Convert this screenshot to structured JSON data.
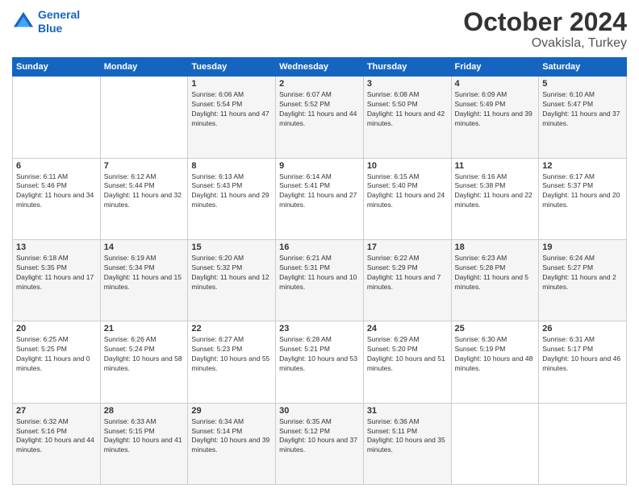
{
  "header": {
    "logo_line1": "General",
    "logo_line2": "Blue",
    "main_title": "October 2024",
    "subtitle": "Ovakisla, Turkey"
  },
  "weekdays": [
    "Sunday",
    "Monday",
    "Tuesday",
    "Wednesday",
    "Thursday",
    "Friday",
    "Saturday"
  ],
  "weeks": [
    [
      {
        "day": "",
        "sunrise": "",
        "sunset": "",
        "daylight": ""
      },
      {
        "day": "",
        "sunrise": "",
        "sunset": "",
        "daylight": ""
      },
      {
        "day": "1",
        "sunrise": "Sunrise: 6:06 AM",
        "sunset": "Sunset: 5:54 PM",
        "daylight": "Daylight: 11 hours and 47 minutes."
      },
      {
        "day": "2",
        "sunrise": "Sunrise: 6:07 AM",
        "sunset": "Sunset: 5:52 PM",
        "daylight": "Daylight: 11 hours and 44 minutes."
      },
      {
        "day": "3",
        "sunrise": "Sunrise: 6:08 AM",
        "sunset": "Sunset: 5:50 PM",
        "daylight": "Daylight: 11 hours and 42 minutes."
      },
      {
        "day": "4",
        "sunrise": "Sunrise: 6:09 AM",
        "sunset": "Sunset: 5:49 PM",
        "daylight": "Daylight: 11 hours and 39 minutes."
      },
      {
        "day": "5",
        "sunrise": "Sunrise: 6:10 AM",
        "sunset": "Sunset: 5:47 PM",
        "daylight": "Daylight: 11 hours and 37 minutes."
      }
    ],
    [
      {
        "day": "6",
        "sunrise": "Sunrise: 6:11 AM",
        "sunset": "Sunset: 5:46 PM",
        "daylight": "Daylight: 11 hours and 34 minutes."
      },
      {
        "day": "7",
        "sunrise": "Sunrise: 6:12 AM",
        "sunset": "Sunset: 5:44 PM",
        "daylight": "Daylight: 11 hours and 32 minutes."
      },
      {
        "day": "8",
        "sunrise": "Sunrise: 6:13 AM",
        "sunset": "Sunset: 5:43 PM",
        "daylight": "Daylight: 11 hours and 29 minutes."
      },
      {
        "day": "9",
        "sunrise": "Sunrise: 6:14 AM",
        "sunset": "Sunset: 5:41 PM",
        "daylight": "Daylight: 11 hours and 27 minutes."
      },
      {
        "day": "10",
        "sunrise": "Sunrise: 6:15 AM",
        "sunset": "Sunset: 5:40 PM",
        "daylight": "Daylight: 11 hours and 24 minutes."
      },
      {
        "day": "11",
        "sunrise": "Sunrise: 6:16 AM",
        "sunset": "Sunset: 5:38 PM",
        "daylight": "Daylight: 11 hours and 22 minutes."
      },
      {
        "day": "12",
        "sunrise": "Sunrise: 6:17 AM",
        "sunset": "Sunset: 5:37 PM",
        "daylight": "Daylight: 11 hours and 20 minutes."
      }
    ],
    [
      {
        "day": "13",
        "sunrise": "Sunrise: 6:18 AM",
        "sunset": "Sunset: 5:35 PM",
        "daylight": "Daylight: 11 hours and 17 minutes."
      },
      {
        "day": "14",
        "sunrise": "Sunrise: 6:19 AM",
        "sunset": "Sunset: 5:34 PM",
        "daylight": "Daylight: 11 hours and 15 minutes."
      },
      {
        "day": "15",
        "sunrise": "Sunrise: 6:20 AM",
        "sunset": "Sunset: 5:32 PM",
        "daylight": "Daylight: 11 hours and 12 minutes."
      },
      {
        "day": "16",
        "sunrise": "Sunrise: 6:21 AM",
        "sunset": "Sunset: 5:31 PM",
        "daylight": "Daylight: 11 hours and 10 minutes."
      },
      {
        "day": "17",
        "sunrise": "Sunrise: 6:22 AM",
        "sunset": "Sunset: 5:29 PM",
        "daylight": "Daylight: 11 hours and 7 minutes."
      },
      {
        "day": "18",
        "sunrise": "Sunrise: 6:23 AM",
        "sunset": "Sunset: 5:28 PM",
        "daylight": "Daylight: 11 hours and 5 minutes."
      },
      {
        "day": "19",
        "sunrise": "Sunrise: 6:24 AM",
        "sunset": "Sunset: 5:27 PM",
        "daylight": "Daylight: 11 hours and 2 minutes."
      }
    ],
    [
      {
        "day": "20",
        "sunrise": "Sunrise: 6:25 AM",
        "sunset": "Sunset: 5:25 PM",
        "daylight": "Daylight: 11 hours and 0 minutes."
      },
      {
        "day": "21",
        "sunrise": "Sunrise: 6:26 AM",
        "sunset": "Sunset: 5:24 PM",
        "daylight": "Daylight: 10 hours and 58 minutes."
      },
      {
        "day": "22",
        "sunrise": "Sunrise: 6:27 AM",
        "sunset": "Sunset: 5:23 PM",
        "daylight": "Daylight: 10 hours and 55 minutes."
      },
      {
        "day": "23",
        "sunrise": "Sunrise: 6:28 AM",
        "sunset": "Sunset: 5:21 PM",
        "daylight": "Daylight: 10 hours and 53 minutes."
      },
      {
        "day": "24",
        "sunrise": "Sunrise: 6:29 AM",
        "sunset": "Sunset: 5:20 PM",
        "daylight": "Daylight: 10 hours and 51 minutes."
      },
      {
        "day": "25",
        "sunrise": "Sunrise: 6:30 AM",
        "sunset": "Sunset: 5:19 PM",
        "daylight": "Daylight: 10 hours and 48 minutes."
      },
      {
        "day": "26",
        "sunrise": "Sunrise: 6:31 AM",
        "sunset": "Sunset: 5:17 PM",
        "daylight": "Daylight: 10 hours and 46 minutes."
      }
    ],
    [
      {
        "day": "27",
        "sunrise": "Sunrise: 6:32 AM",
        "sunset": "Sunset: 5:16 PM",
        "daylight": "Daylight: 10 hours and 44 minutes."
      },
      {
        "day": "28",
        "sunrise": "Sunrise: 6:33 AM",
        "sunset": "Sunset: 5:15 PM",
        "daylight": "Daylight: 10 hours and 41 minutes."
      },
      {
        "day": "29",
        "sunrise": "Sunrise: 6:34 AM",
        "sunset": "Sunset: 5:14 PM",
        "daylight": "Daylight: 10 hours and 39 minutes."
      },
      {
        "day": "30",
        "sunrise": "Sunrise: 6:35 AM",
        "sunset": "Sunset: 5:12 PM",
        "daylight": "Daylight: 10 hours and 37 minutes."
      },
      {
        "day": "31",
        "sunrise": "Sunrise: 6:36 AM",
        "sunset": "Sunset: 5:11 PM",
        "daylight": "Daylight: 10 hours and 35 minutes."
      },
      {
        "day": "",
        "sunrise": "",
        "sunset": "",
        "daylight": ""
      },
      {
        "day": "",
        "sunrise": "",
        "sunset": "",
        "daylight": ""
      }
    ]
  ]
}
